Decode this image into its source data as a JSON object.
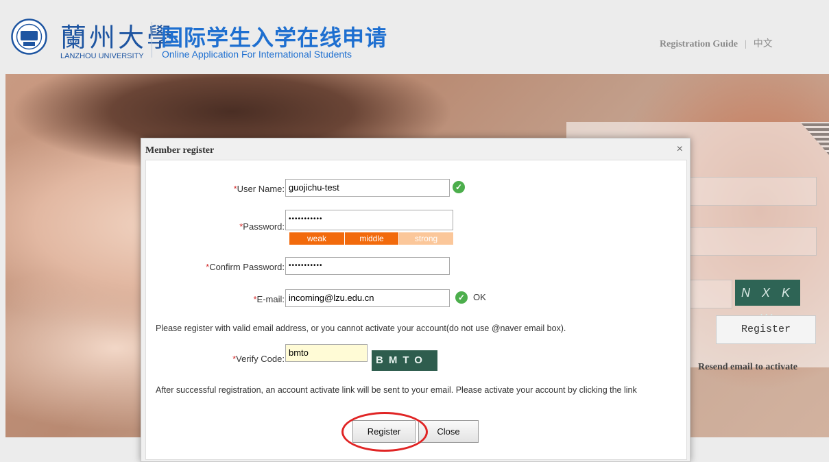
{
  "header": {
    "logo_cn": "蘭州大學",
    "logo_en": "LANZHOU UNIVERSITY",
    "title_cn": "国际学生入学在线申请",
    "title_en": "Online Application For International Students",
    "guide_link": "Registration Guide",
    "separator": "|",
    "lang_link": "中文"
  },
  "login_panel": {
    "captcha_text": "N X K W",
    "register_button": "Register",
    "resend_link": "Resend email to activate"
  },
  "dialog": {
    "title": "Member register",
    "close_glyph": "×",
    "required_mark": "*",
    "fields": {
      "username_label": "User Name:",
      "username_value": "guojichu-test",
      "password_label": "Password:",
      "password_value": "•••••••••••",
      "confirm_label": "Confirm Password:",
      "confirm_value": "•••••••••••",
      "email_label": "E-mail:",
      "email_value": "incoming@lzu.edu.cn",
      "email_status": "OK",
      "verify_label": "Verify Code:",
      "verify_value": "bmto",
      "verify_image_text": "BMTO"
    },
    "strength": {
      "weak": "weak",
      "middle": "middle",
      "strong": "strong",
      "level": 2,
      "active_color": "#f26a0c",
      "inactive_color": "#fbc79a"
    },
    "email_note": "Please register with valid email address, or you cannot activate your account(do not use @naver email box).",
    "activation_note": "After successful registration, an account activate link will be sent to your email. Please activate your account by clicking the link",
    "buttons": {
      "register": "Register",
      "close": "Close"
    },
    "ok_color": "#4cae4c"
  }
}
